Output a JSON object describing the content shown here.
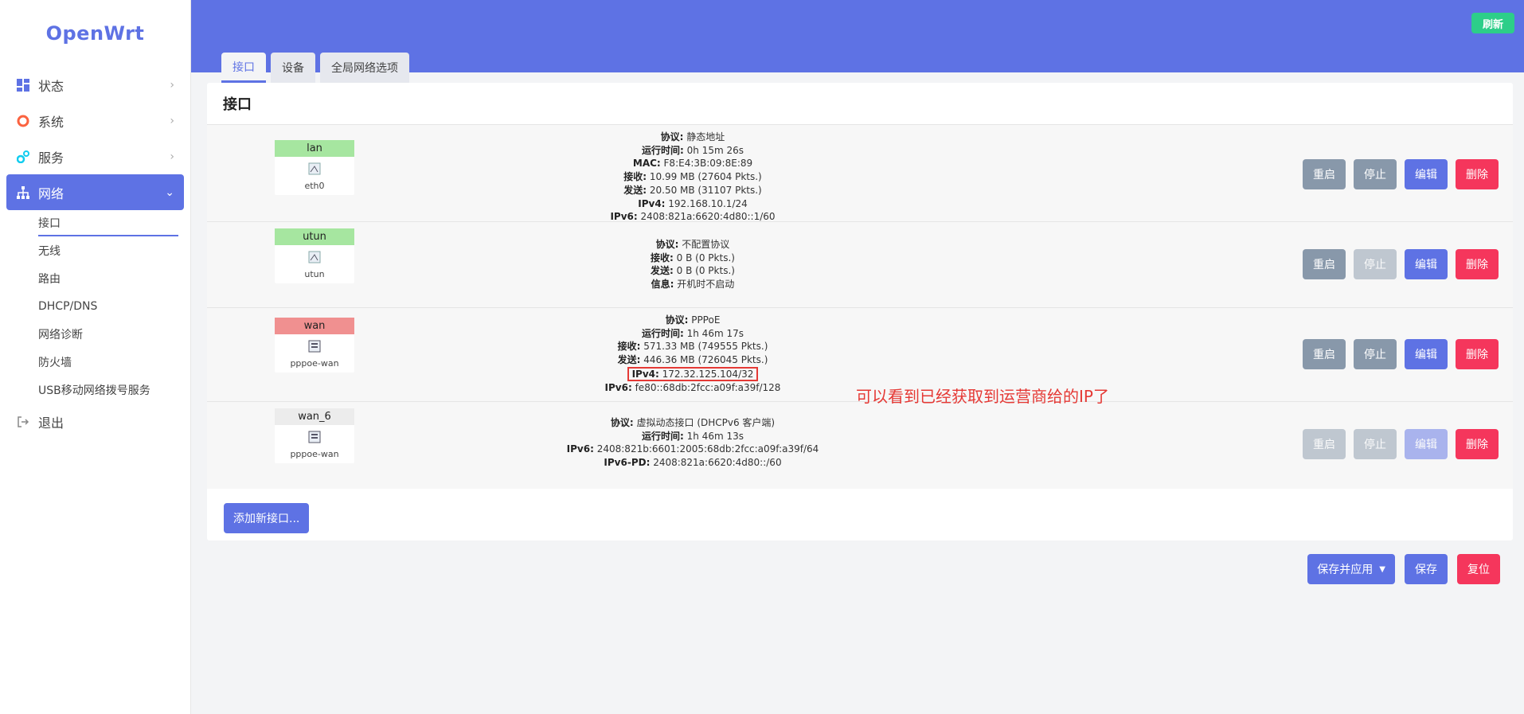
{
  "brand": "OpenWrt",
  "sidebar": {
    "items": [
      {
        "label": "状态"
      },
      {
        "label": "系统"
      },
      {
        "label": "服务"
      },
      {
        "label": "网络"
      },
      {
        "label": "退出"
      }
    ],
    "network_sub": [
      {
        "label": "接口"
      },
      {
        "label": "无线"
      },
      {
        "label": "路由"
      },
      {
        "label": "DHCP/DNS"
      },
      {
        "label": "网络诊断"
      },
      {
        "label": "防火墙"
      },
      {
        "label": "USB移动网络拨号服务"
      }
    ]
  },
  "header": {
    "refresh_label": "刷新",
    "tabs": [
      {
        "label": "接口"
      },
      {
        "label": "设备"
      },
      {
        "label": "全局网络选项"
      }
    ]
  },
  "section_title": "接口",
  "interfaces": [
    {
      "name": "lan",
      "color": "#a6e6a0",
      "device": "eth0",
      "lines": [
        {
          "k": "协议:",
          "v": " 静态地址"
        },
        {
          "k": "运行时间:",
          "v": " 0h 15m 26s"
        },
        {
          "k": "MAC:",
          "v": " F8:E4:3B:09:8E:89"
        },
        {
          "k": "接收:",
          "v": " 10.99 MB (27604 Pkts.)"
        },
        {
          "k": "发送:",
          "v": " 20.50 MB (31107 Pkts.)"
        },
        {
          "k": "IPv4:",
          "v": " 192.168.10.1/24"
        },
        {
          "k": "IPv6:",
          "v": " 2408:821a:6620:4d80::1/60"
        }
      ]
    },
    {
      "name": "utun",
      "color": "#a6e6a0",
      "device": "utun",
      "lines": [
        {
          "k": "协议:",
          "v": " 不配置协议"
        },
        {
          "k": "接收:",
          "v": " 0 B (0 Pkts.)"
        },
        {
          "k": "发送:",
          "v": " 0 B (0 Pkts.)"
        },
        {
          "k": "信息:",
          "v": " 开机时不启动"
        }
      ]
    },
    {
      "name": "wan",
      "color": "#f09090",
      "device": "pppoe-wan",
      "lines": [
        {
          "k": "协议:",
          "v": " PPPoE"
        },
        {
          "k": "运行时间:",
          "v": " 1h 46m 17s"
        },
        {
          "k": "接收:",
          "v": " 571.33 MB (749555 Pkts.)"
        },
        {
          "k": "发送:",
          "v": " 446.36 MB (726045 Pkts.)"
        },
        {
          "k": "IPv4:",
          "v": " 172.32.125.104/32"
        },
        {
          "k": "IPv6:",
          "v": " fe80::68db:2fcc:a09f:a39f/128"
        }
      ]
    },
    {
      "name": "wan_6",
      "color": "#ececec",
      "device": "pppoe-wan",
      "lines": [
        {
          "k": "协议:",
          "v": " 虚拟动态接口 (DHCPv6 客户端)"
        },
        {
          "k": "运行时间:",
          "v": " 1h 46m 13s"
        },
        {
          "k": "IPv6:",
          "v": " 2408:821b:6601:2005:68db:2fcc:a09f:a39f/64"
        },
        {
          "k": "IPv6-PD:",
          "v": " 2408:821a:6620:4d80::/60"
        }
      ]
    }
  ],
  "row_buttons": {
    "restart": "重启",
    "stop": "停止",
    "edit": "编辑",
    "delete": "删除"
  },
  "annotation": "可以看到已经获取到运营商给的IP了",
  "add_interface_label": "添加新接口...",
  "bottom": {
    "save_apply": "保存并应用",
    "save": "保存",
    "reset": "复位"
  }
}
